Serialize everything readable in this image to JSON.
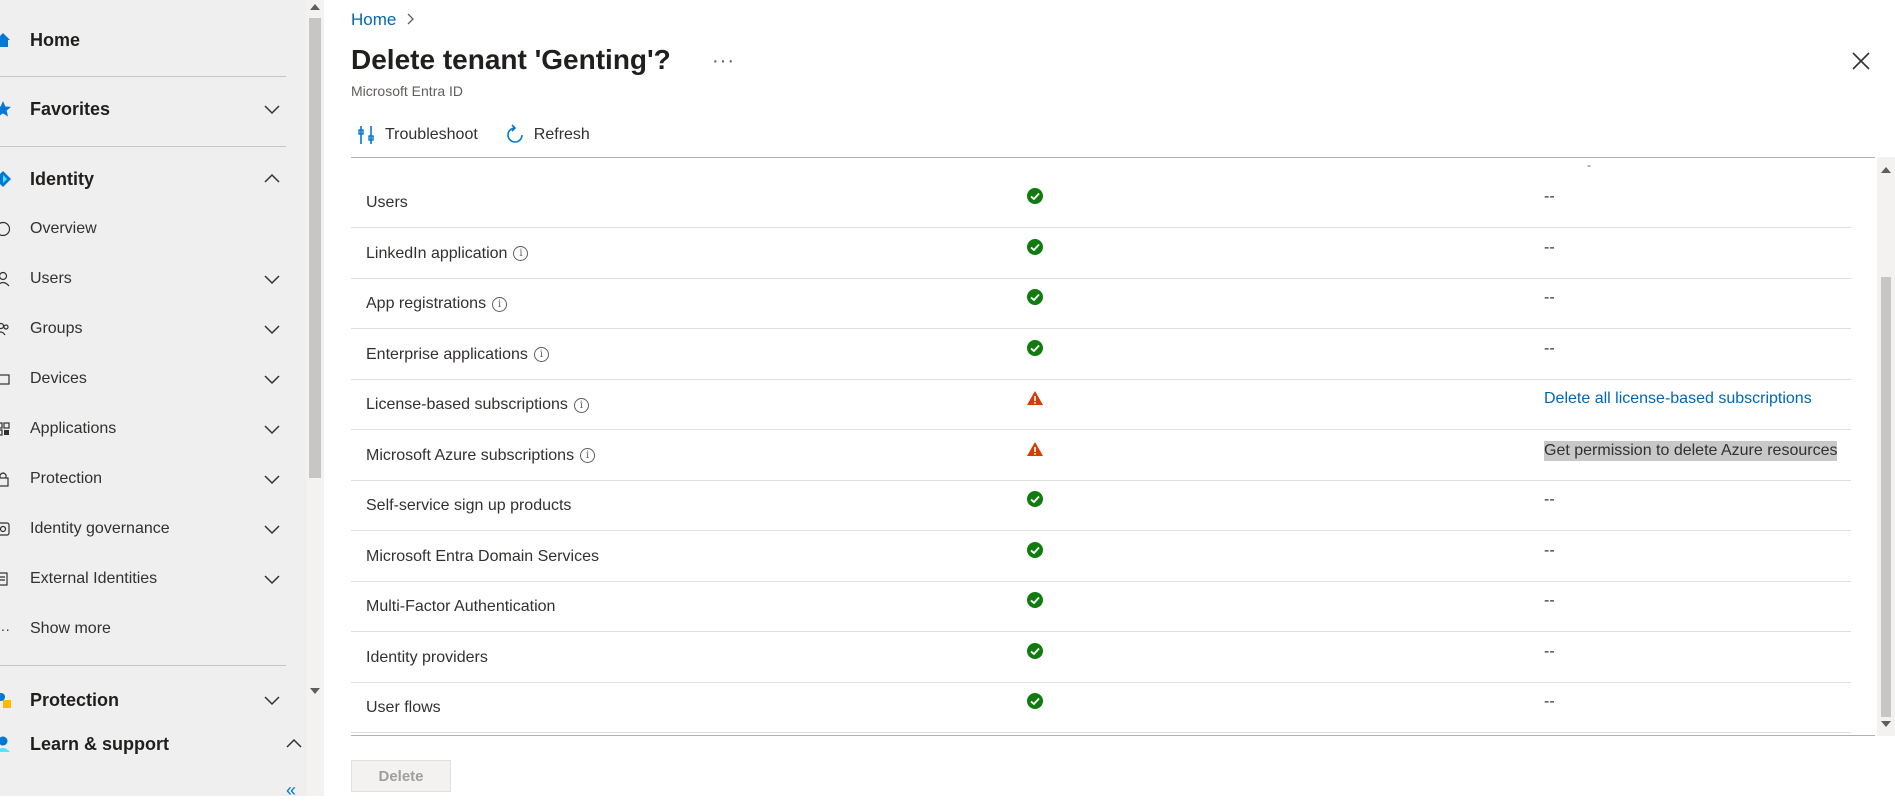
{
  "sidebar": {
    "home": {
      "label": "Home",
      "icon": "home-icon"
    },
    "favorites": {
      "label": "Favorites",
      "icon": "star-icon"
    },
    "identity": {
      "label": "Identity",
      "icon": "identity-diamond-icon"
    },
    "identity_items": [
      {
        "label": "Overview",
        "icon": "info-icon",
        "expandable": false
      },
      {
        "label": "Users",
        "icon": "user-icon",
        "expandable": true
      },
      {
        "label": "Groups",
        "icon": "groups-icon",
        "expandable": true
      },
      {
        "label": "Devices",
        "icon": "device-icon",
        "expandable": true
      },
      {
        "label": "Applications",
        "icon": "applications-icon",
        "expandable": true
      },
      {
        "label": "Protection",
        "icon": "lock-icon",
        "expandable": true
      },
      {
        "label": "Identity governance",
        "icon": "governance-icon",
        "expandable": true
      },
      {
        "label": "External Identities",
        "icon": "external-identities-icon",
        "expandable": true
      },
      {
        "label": "Show more",
        "icon": "more-icon",
        "expandable": false
      }
    ],
    "protection": {
      "label": "Protection",
      "icon": "protection-icon"
    },
    "learn_support": {
      "label": "Learn & support",
      "icon": "support-icon"
    },
    "collapse_label": "«"
  },
  "breadcrumb": {
    "home": "Home"
  },
  "page": {
    "title": "Delete tenant 'Genting'?",
    "subtitle": "Microsoft Entra ID",
    "more": "···"
  },
  "toolbar": {
    "troubleshoot": "Troubleshoot",
    "refresh": "Refresh"
  },
  "table": {
    "rows": [
      {
        "name": "Users",
        "info": false,
        "status": "ok",
        "action": "--",
        "action_type": "dash"
      },
      {
        "name": "LinkedIn application",
        "info": true,
        "status": "ok",
        "action": "--",
        "action_type": "dash"
      },
      {
        "name": "App registrations",
        "info": true,
        "status": "ok",
        "action": "--",
        "action_type": "dash"
      },
      {
        "name": "Enterprise applications",
        "info": true,
        "status": "ok",
        "action": "--",
        "action_type": "dash"
      },
      {
        "name": "License-based subscriptions",
        "info": true,
        "status": "warning",
        "action": "Delete all license-based subscriptions",
        "action_type": "link"
      },
      {
        "name": "Microsoft Azure subscriptions",
        "info": true,
        "status": "warning",
        "action": "Get permission to delete Azure resources",
        "action_type": "selected"
      },
      {
        "name": "Self-service sign up products",
        "info": false,
        "status": "ok",
        "action": "--",
        "action_type": "dash"
      },
      {
        "name": "Microsoft Entra Domain Services",
        "info": false,
        "status": "ok",
        "action": "--",
        "action_type": "dash"
      },
      {
        "name": "Multi-Factor Authentication",
        "info": false,
        "status": "ok",
        "action": "--",
        "action_type": "dash"
      },
      {
        "name": "Identity providers",
        "info": false,
        "status": "ok",
        "action": "--",
        "action_type": "dash"
      },
      {
        "name": "User flows",
        "info": false,
        "status": "ok",
        "action": "--",
        "action_type": "dash"
      }
    ]
  },
  "footer": {
    "delete_label": "Delete"
  },
  "colors": {
    "accent": "#0078d4",
    "ok": "#107c10",
    "warning": "#d83b01",
    "link": "#0067b8"
  }
}
